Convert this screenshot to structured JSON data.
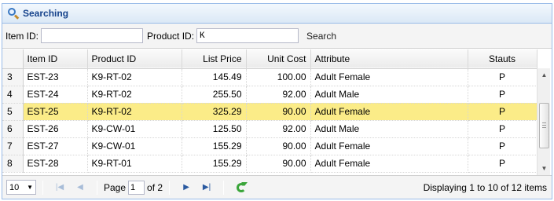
{
  "panel": {
    "title": "Searching"
  },
  "toolbar": {
    "item_id_label": "Item ID:",
    "item_id_value": "",
    "product_id_label": "Product ID:",
    "product_id_value": "K",
    "search_label": "Search"
  },
  "grid": {
    "columns": [
      "Item ID",
      "Product ID",
      "List Price",
      "Unit Cost",
      "Attribute",
      "Stauts"
    ],
    "rows": [
      {
        "rn": "3",
        "item": "EST-23",
        "product": "K9-RT-02",
        "price": "145.49",
        "cost": "100.00",
        "attr": "Adult Female",
        "status": "P",
        "selected": false
      },
      {
        "rn": "4",
        "item": "EST-24",
        "product": "K9-RT-02",
        "price": "255.50",
        "cost": "92.00",
        "attr": "Adult Male",
        "status": "P",
        "selected": false
      },
      {
        "rn": "5",
        "item": "EST-25",
        "product": "K9-RT-02",
        "price": "325.29",
        "cost": "90.00",
        "attr": "Adult Female",
        "status": "P",
        "selected": true
      },
      {
        "rn": "6",
        "item": "EST-26",
        "product": "K9-CW-01",
        "price": "125.50",
        "cost": "92.00",
        "attr": "Adult Male",
        "status": "P",
        "selected": false
      },
      {
        "rn": "7",
        "item": "EST-27",
        "product": "K9-CW-01",
        "price": "155.29",
        "cost": "90.00",
        "attr": "Adult Female",
        "status": "P",
        "selected": false
      },
      {
        "rn": "8",
        "item": "EST-28",
        "product": "K9-RT-01",
        "price": "155.29",
        "cost": "90.00",
        "attr": "Adult Female",
        "status": "P",
        "selected": false
      }
    ]
  },
  "pager": {
    "page_size": "10",
    "page_label": "Page",
    "current_page": "1",
    "of_pages": "of 2",
    "display_text": "Displaying 1 to 10 of 12 items"
  },
  "colors": {
    "header_text": "#15428b",
    "selected_row": "#fbec88",
    "border": "#99bbe8"
  }
}
